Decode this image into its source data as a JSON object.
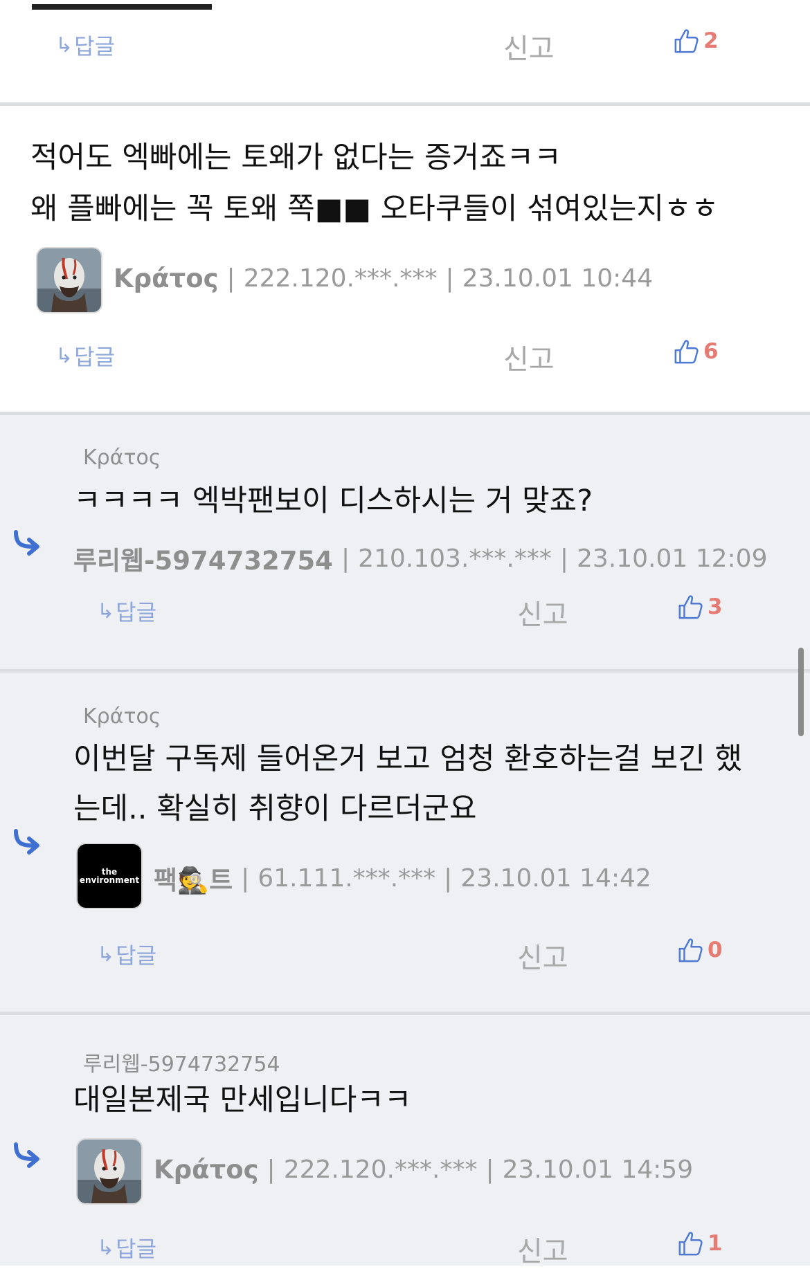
{
  "reply_label": "답글",
  "report_label": "신고",
  "colors": {
    "accent_blue": "#3f6fd1",
    "like_count": "#e57b73",
    "reply_bg": "#eff0f3"
  },
  "top_fragment": {
    "likes": "2"
  },
  "comments": [
    {
      "lines": [
        "적어도 엑빠에는 토왜가 없다는 증거죠ㅋㅋ",
        "왜 플빠에는 꼭 토왜 쪽■■ 오타쿠들이 섞여있는지ㅎㅎ"
      ],
      "nick": "Κράτος",
      "ip": "222.120.***.***",
      "date": "23.10.01 10:44",
      "avatar_icon": "kratos-avatar-icon",
      "likes": "6"
    },
    {
      "parent": "Κράτος",
      "lines": [
        "ㅋㅋㅋㅋ 엑박팬보이 디스하시는 거 맞죠?"
      ],
      "nick": "루리웹-5974732754",
      "ip": "210.103.***.***",
      "date": "23.10.01 12:09",
      "likes": "3"
    },
    {
      "parent": "Κράτος",
      "lines": [
        "이번달 구독제 들어온거 보고 엄청 환호하는걸 보긴 했",
        "는데.. 확실히 취향이 다르더군요"
      ],
      "nick": "팩🕵트",
      "ip": "61.111.***.***",
      "date": "23.10.01 14:42",
      "avatar_text": "the\nenvironment",
      "likes": "0"
    },
    {
      "parent": "루리웹-5974732754",
      "lines": [
        "대일본제국 만세입니다ㅋㅋ"
      ],
      "nick": "Κράτος",
      "ip": "222.120.***.***",
      "date": "23.10.01 14:59",
      "avatar_icon": "kratos-avatar-icon",
      "likes": "1"
    }
  ]
}
